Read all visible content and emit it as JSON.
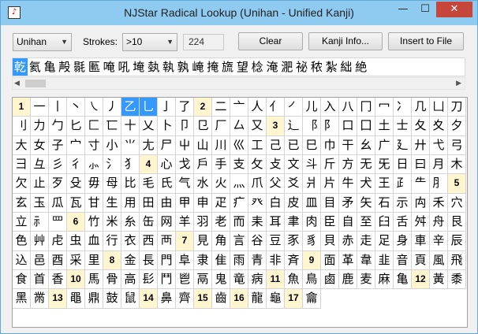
{
  "window": {
    "title": "NJStar Radical Lookup (Unihan - Unified Kanji)",
    "min_glyph": "—",
    "max_glyph": "☐",
    "close_glyph": "✕",
    "app_icon": "note-icon"
  },
  "toolbar": {
    "charset_select": "Unihan",
    "strokes_label": "Strokes:",
    "strokes_select": ">10",
    "count": "224",
    "clear_label": "Clear",
    "kanji_info_label": "Kanji Info...",
    "insert_label": "Insert to File"
  },
  "radical_strip": [
    "乾",
    "氦",
    "亀",
    "殸",
    "毾",
    "匭",
    "唵",
    "吼",
    "埯",
    "埶",
    "執",
    "孰",
    "崦",
    "掩",
    "旒",
    "望",
    "棯",
    "淹",
    "淝",
    "祕",
    "秾",
    "紮",
    "絀",
    "絶"
  ],
  "radical_grid": [
    {
      "t": "1",
      "h": true
    },
    {
      "t": "一"
    },
    {
      "t": "丨"
    },
    {
      "t": "丶"
    },
    {
      "t": "㇏"
    },
    {
      "t": "丿"
    },
    {
      "t": "乙",
      "s": true
    },
    {
      "t": "乚",
      "s": true
    },
    {
      "t": "亅"
    },
    {
      "t": "了"
    },
    {
      "t": "2",
      "h": true
    },
    {
      "t": "二"
    },
    {
      "t": "亠"
    },
    {
      "t": "人"
    },
    {
      "t": "亻"
    },
    {
      "t": "㇒"
    },
    {
      "t": "儿"
    },
    {
      "t": "入"
    },
    {
      "t": "八"
    },
    {
      "t": "冂"
    },
    {
      "t": "冖"
    },
    {
      "t": "冫"
    },
    {
      "t": "几"
    },
    {
      "t": "凵"
    },
    {
      "t": "刀"
    },
    {
      "t": "刂"
    },
    {
      "t": "力"
    },
    {
      "t": "勹"
    },
    {
      "t": "匕"
    },
    {
      "t": "匚"
    },
    {
      "t": "匸"
    },
    {
      "t": "十"
    },
    {
      "t": "乂"
    },
    {
      "t": "卜"
    },
    {
      "t": "卩"
    },
    {
      "t": "㔾"
    },
    {
      "t": "厂"
    },
    {
      "t": "厶"
    },
    {
      "t": "又"
    },
    {
      "t": "3",
      "h": true
    },
    {
      "t": "⻌"
    },
    {
      "t": "⻏"
    },
    {
      "t": "⻖"
    },
    {
      "t": "口"
    },
    {
      "t": "囗"
    },
    {
      "t": "土"
    },
    {
      "t": "士"
    },
    {
      "t": "夂"
    },
    {
      "t": "夊"
    },
    {
      "t": "夕"
    },
    {
      "t": "大"
    },
    {
      "t": "女"
    },
    {
      "t": "子"
    },
    {
      "t": "宀"
    },
    {
      "t": "寸"
    },
    {
      "t": "小"
    },
    {
      "t": "⺌"
    },
    {
      "t": "尢"
    },
    {
      "t": "尸"
    },
    {
      "t": "屮"
    },
    {
      "t": "山"
    },
    {
      "t": "川"
    },
    {
      "t": "巛"
    },
    {
      "t": "工"
    },
    {
      "t": "己"
    },
    {
      "t": "已"
    },
    {
      "t": "巳"
    },
    {
      "t": "巾"
    },
    {
      "t": "干"
    },
    {
      "t": "幺"
    },
    {
      "t": "广"
    },
    {
      "t": "廴"
    },
    {
      "t": "廾"
    },
    {
      "t": "弋"
    },
    {
      "t": "弓"
    },
    {
      "t": "彐"
    },
    {
      "t": "彑"
    },
    {
      "t": "彡"
    },
    {
      "t": "彳"
    },
    {
      "t": "⺗"
    },
    {
      "t": "⺡"
    },
    {
      "t": "⺨"
    },
    {
      "t": "4",
      "h": true
    },
    {
      "t": "心"
    },
    {
      "t": "戈"
    },
    {
      "t": "戶"
    },
    {
      "t": "手"
    },
    {
      "t": "支"
    },
    {
      "t": "攵"
    },
    {
      "t": "攴"
    },
    {
      "t": "文"
    },
    {
      "t": "斗"
    },
    {
      "t": "斤"
    },
    {
      "t": "方"
    },
    {
      "t": "无"
    },
    {
      "t": "旡"
    },
    {
      "t": "日"
    },
    {
      "t": "曰"
    },
    {
      "t": "月"
    },
    {
      "t": "木"
    },
    {
      "t": "欠"
    },
    {
      "t": "止"
    },
    {
      "t": "歹"
    },
    {
      "t": "殳"
    },
    {
      "t": "毋"
    },
    {
      "t": "母"
    },
    {
      "t": "比"
    },
    {
      "t": "毛"
    },
    {
      "t": "氏"
    },
    {
      "t": "气"
    },
    {
      "t": "水"
    },
    {
      "t": "火"
    },
    {
      "t": "灬"
    },
    {
      "t": "爪"
    },
    {
      "t": "父"
    },
    {
      "t": "爻"
    },
    {
      "t": "爿"
    },
    {
      "t": "片"
    },
    {
      "t": "牛"
    },
    {
      "t": "犬"
    },
    {
      "t": "王"
    },
    {
      "t": "⺪"
    },
    {
      "t": "⺧"
    },
    {
      "t": "⺼"
    },
    {
      "t": "5",
      "h": true
    },
    {
      "t": "玄"
    },
    {
      "t": "玉"
    },
    {
      "t": "瓜"
    },
    {
      "t": "瓦"
    },
    {
      "t": "甘"
    },
    {
      "t": "生"
    },
    {
      "t": "用"
    },
    {
      "t": "田"
    },
    {
      "t": "由"
    },
    {
      "t": "甲"
    },
    {
      "t": "申"
    },
    {
      "t": "疋"
    },
    {
      "t": "疒"
    },
    {
      "t": "癶"
    },
    {
      "t": "白"
    },
    {
      "t": "皮"
    },
    {
      "t": "皿"
    },
    {
      "t": "目"
    },
    {
      "t": "矛"
    },
    {
      "t": "矢"
    },
    {
      "t": "石"
    },
    {
      "t": "示"
    },
    {
      "t": "禸"
    },
    {
      "t": "禾"
    },
    {
      "t": "穴"
    },
    {
      "t": "立"
    },
    {
      "t": "⺬"
    },
    {
      "t": "罒"
    },
    {
      "t": "6",
      "h": true
    },
    {
      "t": "竹"
    },
    {
      "t": "米"
    },
    {
      "t": "糸"
    },
    {
      "t": "缶"
    },
    {
      "t": "网"
    },
    {
      "t": "羊"
    },
    {
      "t": "羽"
    },
    {
      "t": "老"
    },
    {
      "t": "而"
    },
    {
      "t": "耒"
    },
    {
      "t": "耳"
    },
    {
      "t": "聿"
    },
    {
      "t": "肉"
    },
    {
      "t": "臣"
    },
    {
      "t": "自"
    },
    {
      "t": "至"
    },
    {
      "t": "臼"
    },
    {
      "t": "舌"
    },
    {
      "t": "舛"
    },
    {
      "t": "舟"
    },
    {
      "t": "艮"
    },
    {
      "t": "色"
    },
    {
      "t": "艸"
    },
    {
      "t": "虍"
    },
    {
      "t": "虫"
    },
    {
      "t": "血"
    },
    {
      "t": "行"
    },
    {
      "t": "衣"
    },
    {
      "t": "西"
    },
    {
      "t": "襾"
    },
    {
      "t": "7",
      "h": true
    },
    {
      "t": "見"
    },
    {
      "t": "角"
    },
    {
      "t": "言"
    },
    {
      "t": "谷"
    },
    {
      "t": "豆"
    },
    {
      "t": "豕"
    },
    {
      "t": "豸"
    },
    {
      "t": "貝"
    },
    {
      "t": "赤"
    },
    {
      "t": "走"
    },
    {
      "t": "足"
    },
    {
      "t": "身"
    },
    {
      "t": "車"
    },
    {
      "t": "辛"
    },
    {
      "t": "辰"
    },
    {
      "t": "込"
    },
    {
      "t": "邑"
    },
    {
      "t": "酉"
    },
    {
      "t": "采"
    },
    {
      "t": "里"
    },
    {
      "t": "8",
      "h": true
    },
    {
      "t": "金"
    },
    {
      "t": "長"
    },
    {
      "t": "門"
    },
    {
      "t": "阜"
    },
    {
      "t": "隶"
    },
    {
      "t": "隹"
    },
    {
      "t": "雨"
    },
    {
      "t": "青"
    },
    {
      "t": "非"
    },
    {
      "t": "斉"
    },
    {
      "t": "9",
      "h": true
    },
    {
      "t": "面"
    },
    {
      "t": "革"
    },
    {
      "t": "韋"
    },
    {
      "t": "韭"
    },
    {
      "t": "音"
    },
    {
      "t": "頁"
    },
    {
      "t": "風"
    },
    {
      "t": "飛"
    },
    {
      "t": "食"
    },
    {
      "t": "首"
    },
    {
      "t": "香"
    },
    {
      "t": "10",
      "h": true
    },
    {
      "t": "馬"
    },
    {
      "t": "骨"
    },
    {
      "t": "高"
    },
    {
      "t": "髟"
    },
    {
      "t": "鬥"
    },
    {
      "t": "鬯"
    },
    {
      "t": "鬲"
    },
    {
      "t": "鬼"
    },
    {
      "t": "竜"
    },
    {
      "t": "病"
    },
    {
      "t": "11",
      "h": true
    },
    {
      "t": "魚"
    },
    {
      "t": "鳥"
    },
    {
      "t": "鹵"
    },
    {
      "t": "鹿"
    },
    {
      "t": "麦"
    },
    {
      "t": "麻"
    },
    {
      "t": "亀"
    },
    {
      "t": "12",
      "h": true
    },
    {
      "t": "黃"
    },
    {
      "t": "黍"
    },
    {
      "t": "黑"
    },
    {
      "t": "黹"
    },
    {
      "t": "13",
      "h": true
    },
    {
      "t": "黽"
    },
    {
      "t": "鼎"
    },
    {
      "t": "鼓"
    },
    {
      "t": "鼠"
    },
    {
      "t": "14",
      "h": true
    },
    {
      "t": "鼻"
    },
    {
      "t": "齊"
    },
    {
      "t": "15",
      "h": true
    },
    {
      "t": "齒"
    },
    {
      "t": "16",
      "h": true
    },
    {
      "t": "龍"
    },
    {
      "t": "龜"
    },
    {
      "t": "17",
      "h": true
    },
    {
      "t": "龠"
    }
  ]
}
